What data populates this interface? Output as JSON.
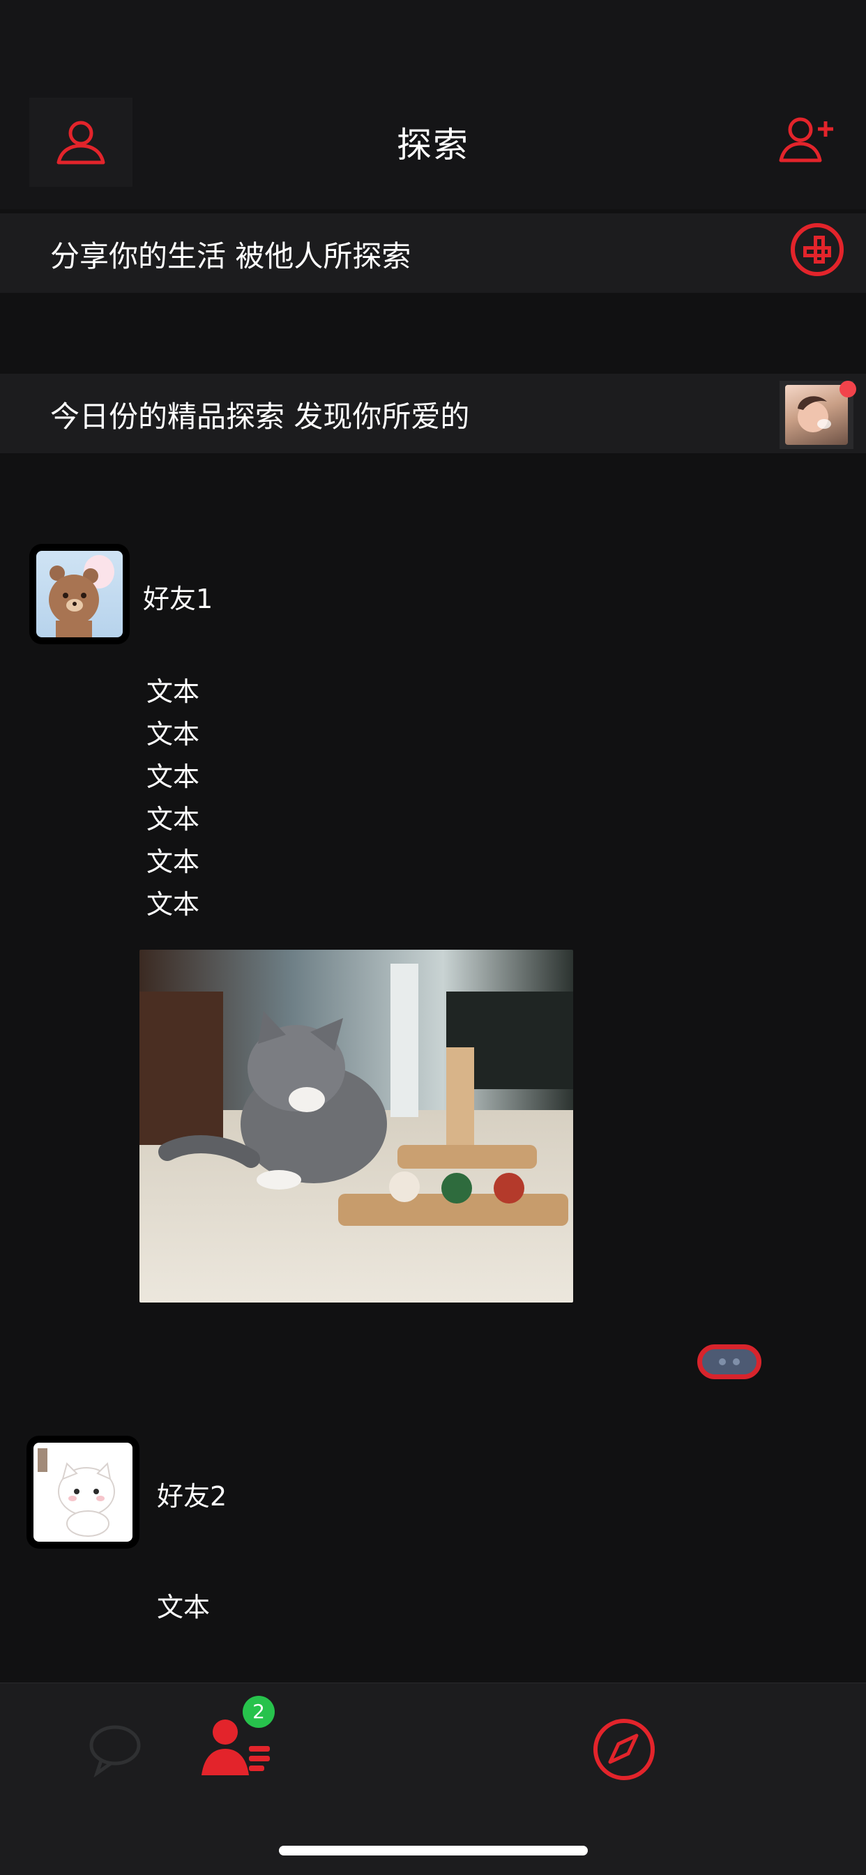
{
  "header": {
    "title": "探索",
    "left_icon": "user-icon",
    "right_icon": "add-user-icon"
  },
  "banners": {
    "share": {
      "text": "分享你的生活 被他人所探索",
      "icon": "plus-circle-icon"
    },
    "today": {
      "text": "今日份的精品探索 发现你所爱的",
      "has_unread_dot": true
    }
  },
  "feed": [
    {
      "name": "好友1",
      "lines": [
        "文本",
        "文本",
        "文本",
        "文本",
        "文本",
        "文本"
      ],
      "has_image": true
    },
    {
      "name": "好友2",
      "lines": [
        "文本"
      ]
    }
  ],
  "tabbar": {
    "contacts_badge": "2",
    "icons": [
      "chat-icon",
      "contacts-icon",
      "compass-icon"
    ]
  },
  "colors": {
    "accent": "#e3242b",
    "background": "#111112",
    "panel": "#1c1c1e",
    "badge": "#27c24c"
  }
}
